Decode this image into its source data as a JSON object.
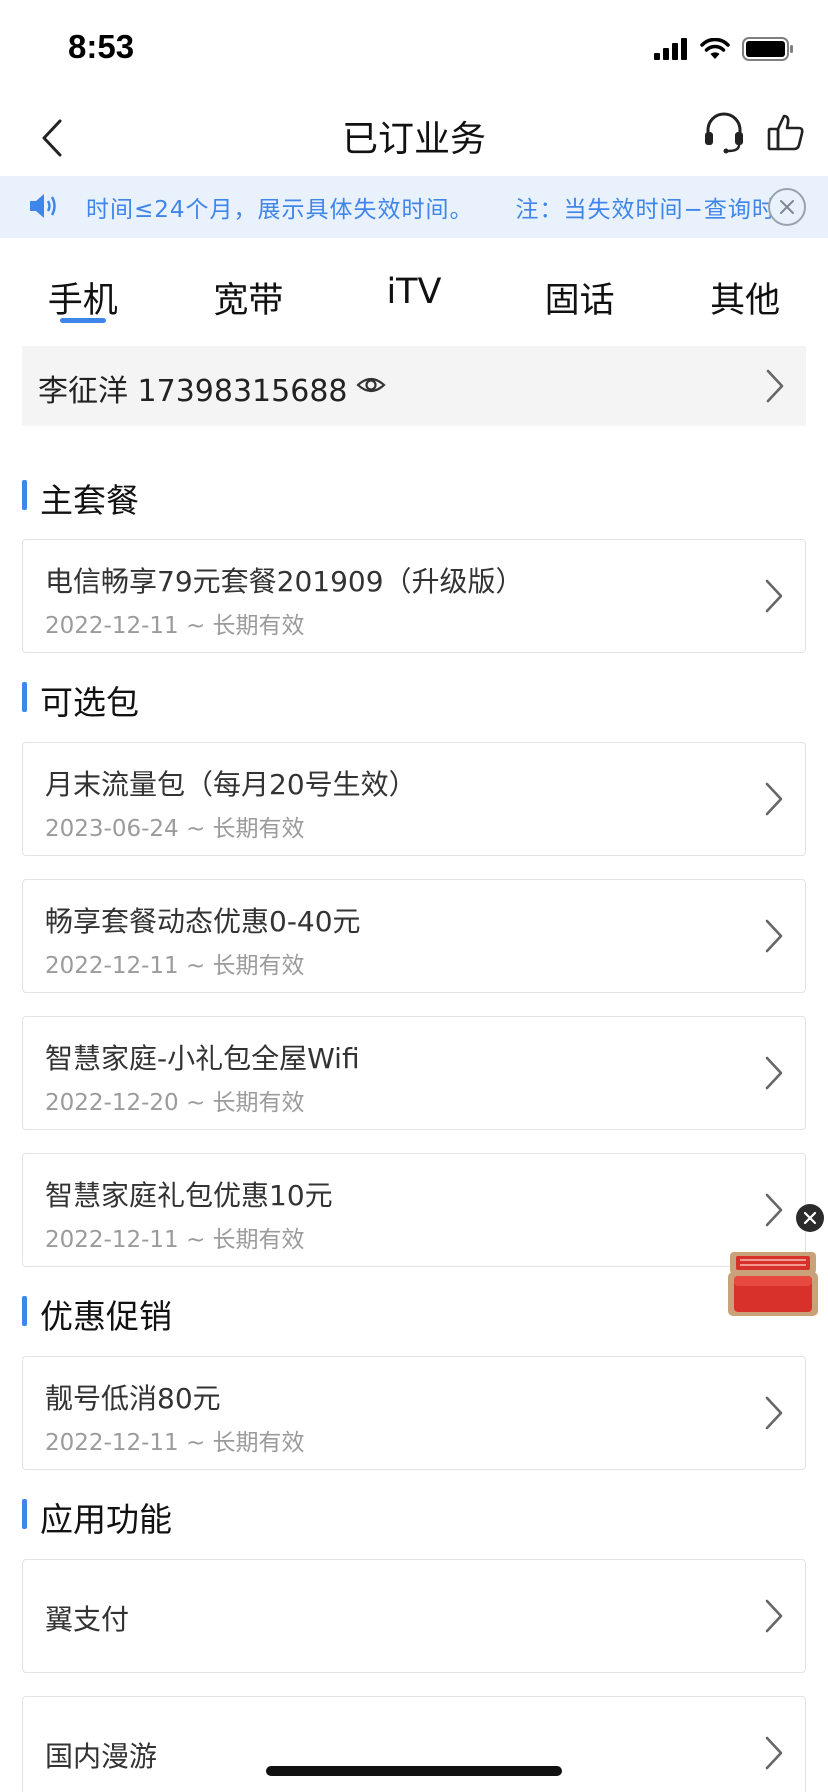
{
  "status": {
    "time": "8:53"
  },
  "header": {
    "title": "已订业务"
  },
  "notice": {
    "text1": "时间≤24个月，展示具体失效时间。",
    "text2": "注：当失效时间−查询时"
  },
  "tabs": [
    {
      "label": "手机",
      "active": true
    },
    {
      "label": "宽带"
    },
    {
      "label": "iTV"
    },
    {
      "label": "固话"
    },
    {
      "label": "其他"
    }
  ],
  "account": {
    "name_phone": "李征洋 17398315688"
  },
  "sections": {
    "main_plan": {
      "title": "主套餐",
      "items": [
        {
          "name": "电信畅享79元套餐201909（升级版）",
          "date": "2022-12-11 ~ 长期有效"
        }
      ]
    },
    "optional": {
      "title": "可选包",
      "items": [
        {
          "name": "月末流量包（每月20号生效）",
          "date": "2023-06-24 ~ 长期有效"
        },
        {
          "name": "畅享套餐动态优惠0-40元",
          "date": "2022-12-11 ~ 长期有效"
        },
        {
          "name": "智慧家庭-小礼包全屋Wifi",
          "date": "2022-12-20 ~ 长期有效"
        },
        {
          "name": "智慧家庭礼包优惠10元",
          "date": "2022-12-11 ~ 长期有效"
        }
      ]
    },
    "promo": {
      "title": "优惠促销",
      "items": [
        {
          "name": "靓号低消80元",
          "date": "2022-12-11 ~ 长期有效"
        }
      ]
    },
    "apps": {
      "title": "应用功能",
      "items": [
        {
          "name": "翼支付"
        },
        {
          "name": "国内漫游"
        }
      ]
    }
  },
  "colors": {
    "accent": "#3f86ea",
    "notice_bg": "#e9f1fd",
    "gift_red": "#d8302a"
  }
}
